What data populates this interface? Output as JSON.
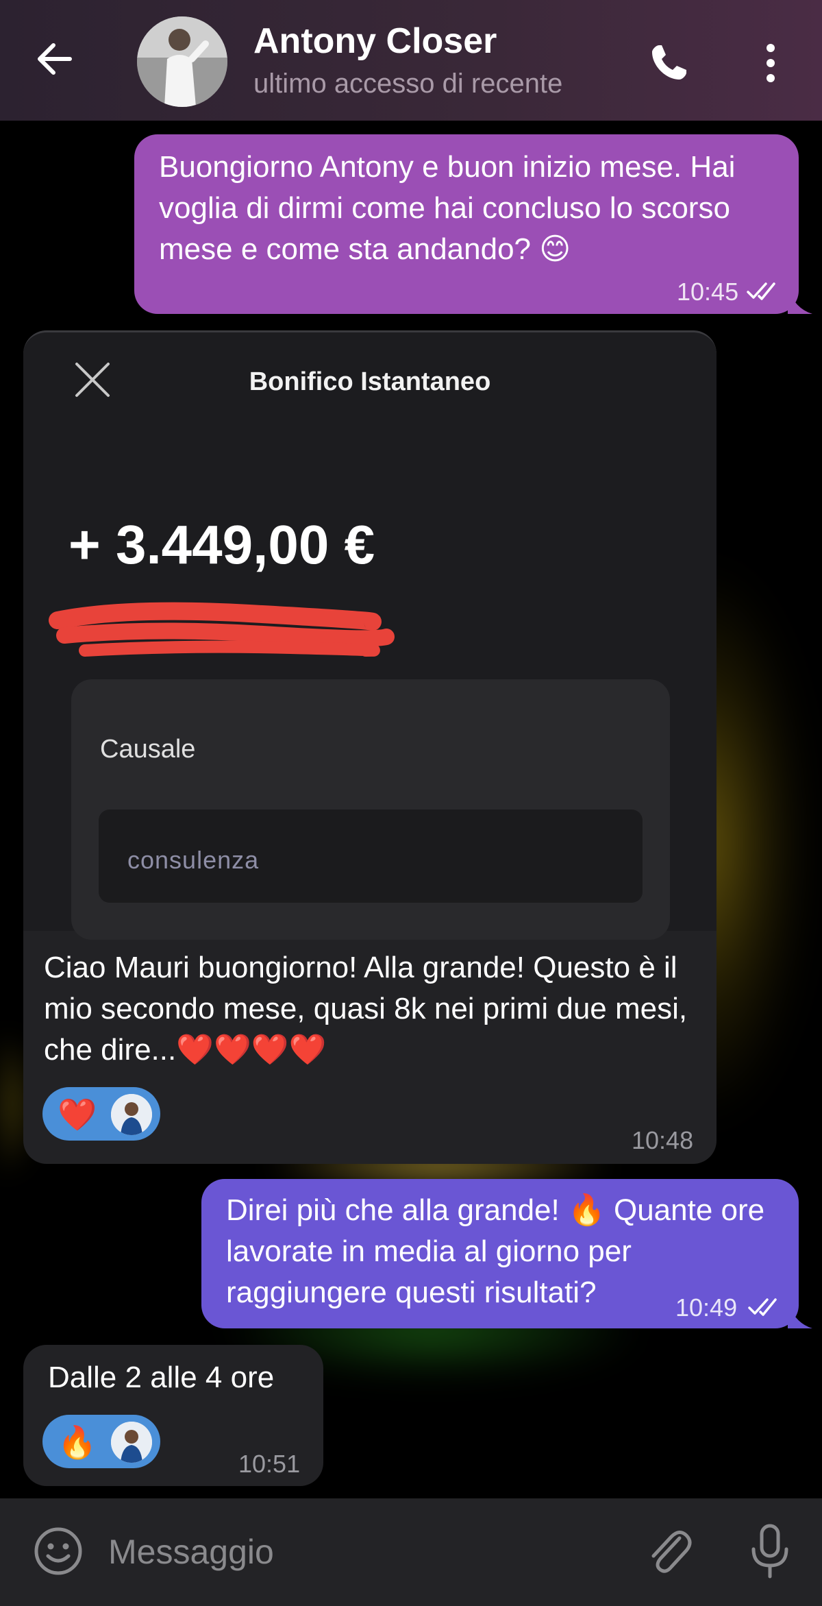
{
  "header": {
    "contact_name": "Antony Closer",
    "status": "ultimo accesso di recente",
    "icons": [
      "back-arrow-icon",
      "phone-icon",
      "more-vert-icon"
    ]
  },
  "messages": [
    {
      "direction": "outgoing",
      "text": "Buongiorno Antony e buon inizio mese. Hai voglia di dirmi come hai concluso lo scorso mese e come sta andando? 😊",
      "time": "10:45",
      "status": "read"
    },
    {
      "direction": "incoming",
      "image": {
        "title": "Bonifico Istantaneo",
        "amount": "+ 3.449,00 €",
        "causale_label": "Causale",
        "causale_value": "consulenza"
      },
      "text": "Ciao Mauri buongiorno! Alla grande! Questo è il mio secondo mese, quasi 8k nei primi due mesi, che dire...❤️❤️❤️❤️",
      "reaction": "❤️",
      "time": "10:48"
    },
    {
      "direction": "outgoing",
      "text": "Direi più che alla grande! 🔥 Quante ore lavorate in media al giorno per raggiungere questi risultati?",
      "time": "10:49",
      "status": "read"
    },
    {
      "direction": "incoming",
      "text": "Dalle 2 alle 4 ore",
      "reaction": "🔥",
      "time": "10:51"
    }
  ],
  "composer": {
    "placeholder": "Messaggio"
  },
  "colors": {
    "outgoing_bubble_1": "#9b4fb5",
    "outgoing_bubble_2": "#6a56d4",
    "incoming_bubble": "#222225",
    "reaction_pill": "#4a8fd8"
  }
}
